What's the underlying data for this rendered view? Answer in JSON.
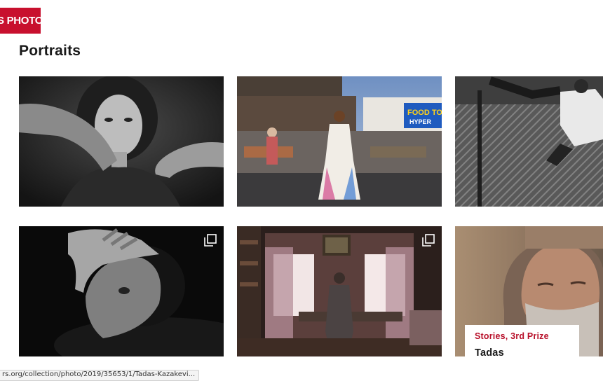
{
  "brand": {
    "logo_text": "S PHOTO",
    "accent_color": "#c8102e"
  },
  "section": {
    "title": "Portraits"
  },
  "tiles": [
    {
      "name": "photo-woman-hands-shoulders",
      "gallery": false
    },
    {
      "name": "photo-woman-white-dress-market",
      "gallery": false,
      "signs": {
        "left": "FOOD TOWN",
        "right": "HYPER"
      }
    },
    {
      "name": "photo-dancer-fence",
      "gallery": false
    },
    {
      "name": "photo-boy-hand-on-head",
      "gallery": true,
      "icon": "multiple-photos-icon"
    },
    {
      "name": "photo-woman-window-room",
      "gallery": true,
      "icon": "multiple-photos-icon"
    },
    {
      "name": "photo-bearded-man",
      "gallery": false,
      "caption": {
        "category": "Stories, 3rd Prize",
        "name": "Tadas Kazakevičius"
      }
    }
  ],
  "status_bar": {
    "url": "rs.org/collection/photo/2019/35653/1/Tadas-Kazakevi..."
  }
}
